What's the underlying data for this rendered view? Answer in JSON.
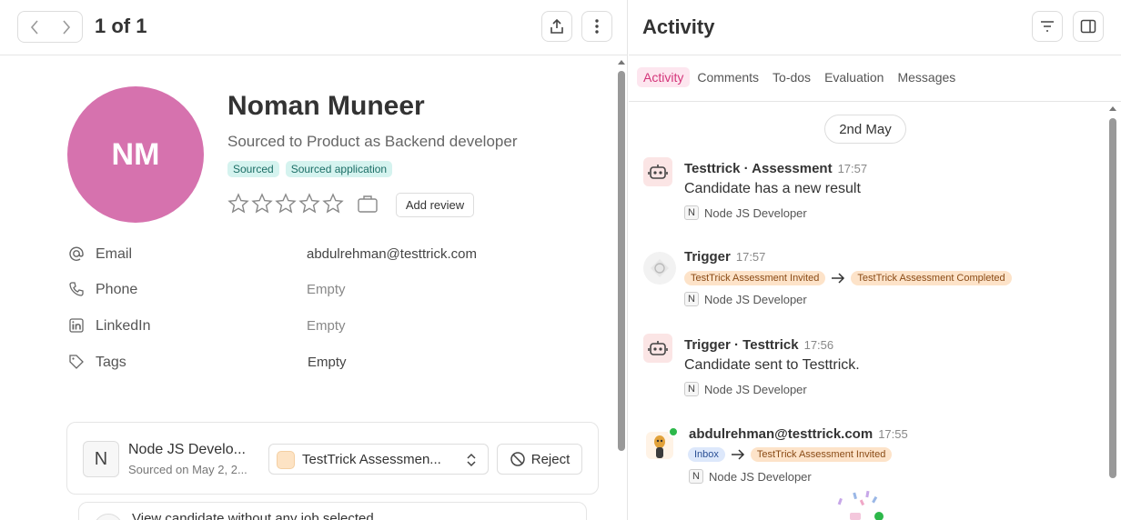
{
  "left": {
    "counter": "1 of 1",
    "candidate": {
      "initials": "NM",
      "name": "Noman Muneer",
      "subtitle": "Sourced to Product as Backend developer",
      "tags": [
        "Sourced",
        "Sourced application"
      ],
      "rating": 0,
      "rating_max": 5,
      "add_review_label": "Add review"
    },
    "fields": [
      {
        "label": "Email",
        "value": "abdulrehman@testtrick.com",
        "icon": "at-icon"
      },
      {
        "label": "Phone",
        "value": "Empty",
        "icon": "phone-icon"
      },
      {
        "label": "LinkedIn",
        "value": "Empty",
        "icon": "linkedin-icon"
      },
      {
        "label": "Tags",
        "value": "Empty",
        "icon": "tag-icon"
      }
    ],
    "job_card": {
      "letter": "N",
      "title": "Node JS Develo...",
      "subtitle": "Sourced on May 2, 2...",
      "stage": "TestTrick Assessmen...",
      "reject_label": "Reject"
    },
    "second_card": {
      "text": "View candidate without any job selected"
    }
  },
  "right": {
    "title": "Activity",
    "tabs": [
      "Activity",
      "Comments",
      "To-dos",
      "Evaluation",
      "Messages"
    ],
    "active_tab": "Activity",
    "date": "2nd May",
    "events": [
      {
        "title": "Testtrick · Assessment",
        "time": "17:57",
        "text": "Candidate has a new result",
        "job_letter": "N",
        "job": "Node JS Developer"
      },
      {
        "title": "Trigger",
        "time": "17:57",
        "from": "TestTrick Assessment Invited",
        "to": "TestTrick Assessment Completed",
        "job_letter": "N",
        "job": "Node JS Developer"
      },
      {
        "title": "Trigger · Testtrick",
        "time": "17:56",
        "text": "Candidate sent to Testtrick.",
        "job_letter": "N",
        "job": "Node JS Developer"
      },
      {
        "title": "abdulrehman@testtrick.com",
        "time": "17:55",
        "from": "Inbox",
        "to": "TestTrick Assessment Invited",
        "job_letter": "N",
        "job": "Node JS Developer"
      }
    ]
  },
  "colors": {
    "avatar": "#d672ae",
    "accent": "#d4357a",
    "tag_bg": "#d5f3ef",
    "chip_orange": "#fde3c9",
    "chip_blue": "#dde8fb",
    "online": "#2db84a"
  }
}
